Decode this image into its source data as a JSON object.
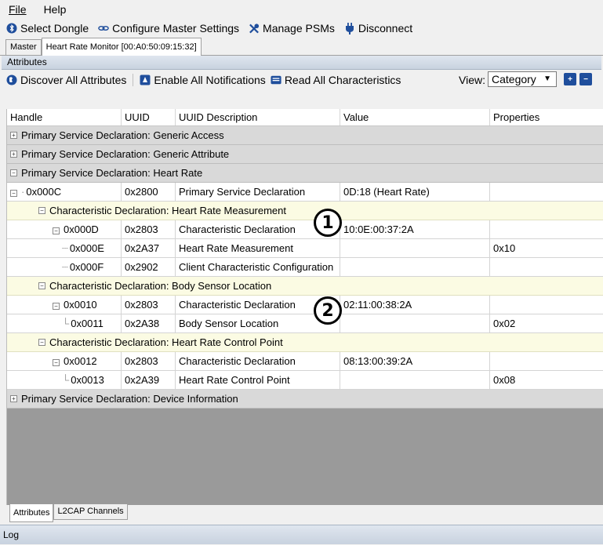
{
  "menu": {
    "file": "File",
    "help": "Help"
  },
  "toolbar": {
    "select_dongle": "Select Dongle",
    "configure_master": "Configure Master Settings",
    "manage_psms": "Manage PSMs",
    "disconnect": "Disconnect"
  },
  "tabs": {
    "master": "Master",
    "device": "Heart Rate Monitor [00:A0:50:09:15:32]"
  },
  "panel": {
    "title": "Attributes",
    "discover": "Discover All Attributes",
    "enable_notifications": "Enable All Notifications",
    "read_all": "Read All Characteristics",
    "view_label": "View:",
    "view_value": "Category"
  },
  "columns": {
    "handle": "Handle",
    "uuid": "UUID",
    "desc": "UUID Description",
    "value": "Value",
    "props": "Properties"
  },
  "rows": {
    "g1": "Primary Service Declaration: Generic Access",
    "g2": "Primary Service Declaration: Generic Attribute",
    "g3": "Primary Service Declaration: Heart Rate",
    "r1": {
      "handle": "0x000C",
      "uuid": "0x2800",
      "desc": "Primary Service Declaration",
      "value": "0D:18 (Heart Rate)",
      "props": ""
    },
    "c1": "Characteristic Declaration: Heart Rate Measurement",
    "r2": {
      "handle": "0x000D",
      "uuid": "0x2803",
      "desc": "Characteristic Declaration",
      "value": "10:0E:00:37:2A",
      "props": ""
    },
    "r3": {
      "handle": "0x000E",
      "uuid": "0x2A37",
      "desc": "Heart Rate Measurement",
      "value": "",
      "props": "0x10"
    },
    "r4": {
      "handle": "0x000F",
      "uuid": "0x2902",
      "desc": "Client Characteristic Configuration",
      "value": "",
      "props": ""
    },
    "c2": "Characteristic Declaration: Body Sensor Location",
    "r5": {
      "handle": "0x0010",
      "uuid": "0x2803",
      "desc": "Characteristic Declaration",
      "value": "02:11:00:38:2A",
      "props": ""
    },
    "r6": {
      "handle": "0x0011",
      "uuid": "0x2A38",
      "desc": "Body Sensor Location",
      "value": "",
      "props": "0x02"
    },
    "c3": "Characteristic Declaration: Heart Rate Control Point",
    "r7": {
      "handle": "0x0012",
      "uuid": "0x2803",
      "desc": "Characteristic Declaration",
      "value": "08:13:00:39:2A",
      "props": ""
    },
    "r8": {
      "handle": "0x0013",
      "uuid": "0x2A39",
      "desc": "Heart Rate Control Point",
      "value": "",
      "props": "0x08"
    },
    "g4": "Primary Service Declaration: Device Information"
  },
  "callouts": {
    "one": "1",
    "two": "2"
  },
  "bottom_tabs": {
    "attributes": "Attributes",
    "l2cap": "L2CAP Channels"
  },
  "log": "Log"
}
